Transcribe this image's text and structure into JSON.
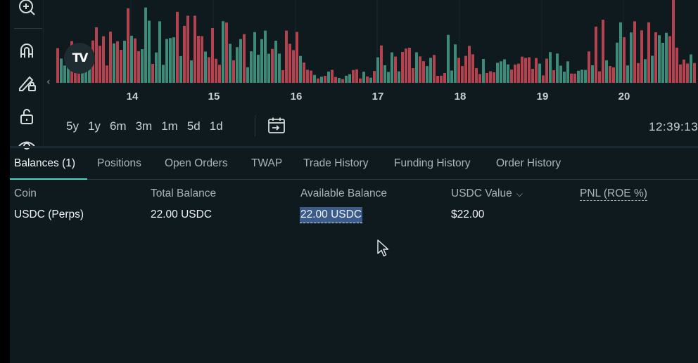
{
  "chart": {
    "x_labels": [
      "14",
      "15",
      "16",
      "17",
      "18",
      "19",
      "20"
    ],
    "time": "12:39:13",
    "ranges": [
      "5y",
      "1y",
      "6m",
      "3m",
      "1m",
      "5d",
      "1d"
    ],
    "colors": {
      "up": "#3d8b79",
      "down": "#b5434f",
      "bg": "#0f1a1f"
    },
    "icons": [
      "zoom-in-icon",
      "magnet-icon",
      "pencil-lock-icon",
      "unlock-icon",
      "eye-icon",
      "calendar-goto-icon",
      "tradingview-logo"
    ]
  },
  "tabs": [
    {
      "label": "Balances (1)",
      "active": true
    },
    {
      "label": "Positions"
    },
    {
      "label": "Open Orders"
    },
    {
      "label": "TWAP"
    },
    {
      "label": "Trade History"
    },
    {
      "label": "Funding History"
    },
    {
      "label": "Order History"
    }
  ],
  "table": {
    "headers": [
      "Coin",
      "Total Balance",
      "Available Balance",
      "USDC Value",
      "PNL (ROE %)"
    ],
    "rows": [
      [
        "USDC (Perps)",
        "22.00 USDC",
        "22.00 USDC",
        "$22.00",
        ""
      ]
    ]
  }
}
